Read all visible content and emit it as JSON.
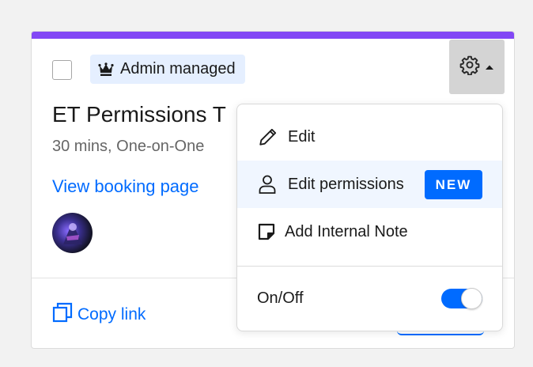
{
  "card": {
    "accent_color": "#8247f5",
    "badge_label": "Admin managed",
    "title": "ET Permissions T",
    "subtitle": "30 mins, One-on-One",
    "view_link": "View booking page",
    "copy_link": "Copy link"
  },
  "menu": {
    "edit": "Edit",
    "edit_permissions": "Edit permissions",
    "new_badge": "NEW",
    "add_note": "Add Internal Note",
    "toggle_label": "On/Off",
    "toggle_on": true
  },
  "icons": {
    "badge": "crown-icon",
    "settings": "gear-icon",
    "caret": "caret-up-icon",
    "edit": "pencil-icon",
    "permissions": "user-icon",
    "note": "note-icon",
    "copy": "copy-icon"
  },
  "colors": {
    "link": "#006bff",
    "badge_bg": "#e5efff",
    "highlight": "#f0f6ff"
  }
}
